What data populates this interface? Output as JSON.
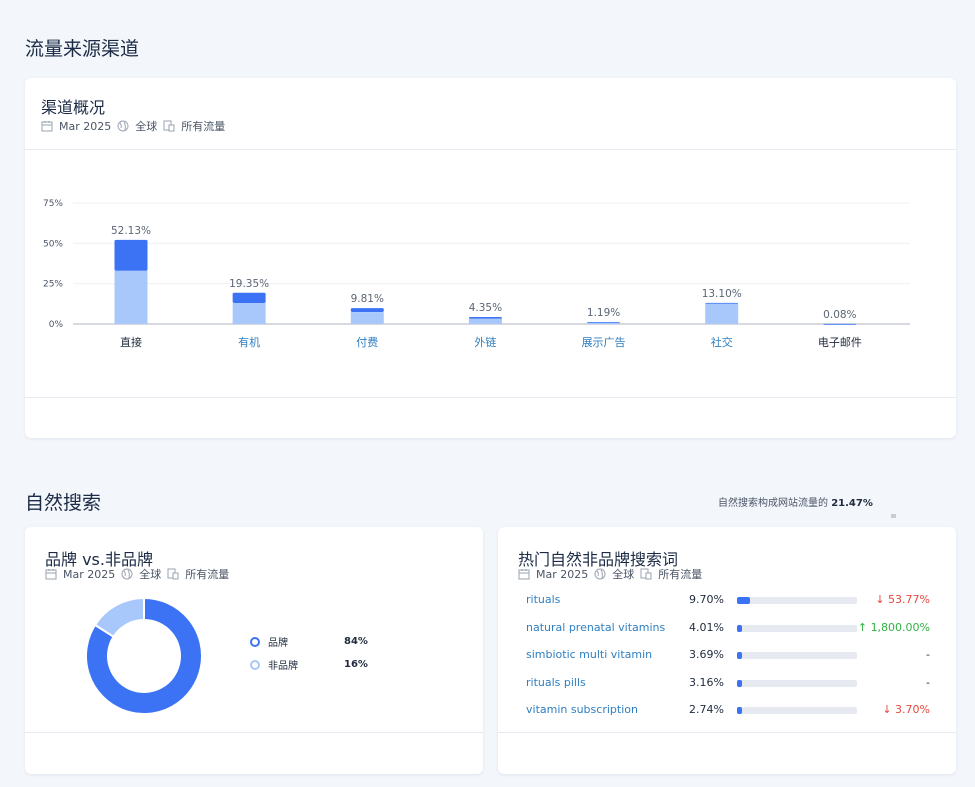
{
  "traffic_section": {
    "title": "流量来源渠道"
  },
  "channel_card": {
    "title": "渠道概况",
    "meta": {
      "date": "Mar 2025",
      "region": "全球",
      "traffic": "所有流量"
    }
  },
  "chart_data": {
    "type": "bar",
    "title": "",
    "ylabel": "",
    "ylim": [
      0,
      75
    ],
    "yticks": [
      "0%",
      "25%",
      "50%",
      "75%"
    ],
    "yticks_values": [
      0,
      25,
      50,
      75
    ],
    "categories": [
      "直接",
      "有机",
      "付费",
      "外链",
      "展示广告",
      "社交",
      "电子邮件"
    ],
    "values": [
      52.13,
      19.35,
      9.81,
      4.35,
      1.19,
      13.1,
      0.08
    ],
    "data_labels": [
      "52.13%",
      "19.35%",
      "9.81%",
      "4.35%",
      "1.19%",
      "13.10%",
      "0.08%"
    ],
    "lower_segment_values": [
      33.0,
      13.0,
      7.4,
      3.3,
      1.0,
      12.7,
      0.06
    ],
    "category_link": [
      false,
      true,
      true,
      true,
      true,
      true,
      false
    ],
    "colors": {
      "top": "#3b73f4",
      "bottom": "#a8c8fb",
      "link": "#2e7fc1",
      "text": "#1f2a3c"
    },
    "grid": true
  },
  "organic_section": {
    "title": "自然搜索",
    "share_text": "自然搜索构成网站流量的",
    "share_value": "21.47%"
  },
  "brand_card": {
    "title": "品牌 vs.非品牌",
    "meta": {
      "date": "Mar 2025",
      "region": "全球",
      "traffic": "所有流量"
    },
    "donut": [
      {
        "label": "品牌",
        "value": "84%",
        "fraction": 0.84,
        "color": "#3b73f4"
      },
      {
        "label": "非品牌",
        "value": "16%",
        "fraction": 0.16,
        "color": "#a8c8fb"
      }
    ]
  },
  "keywords_card": {
    "title": "热门自然非品牌搜索词",
    "meta": {
      "date": "Mar 2025",
      "region": "全球",
      "traffic": "所有流量"
    },
    "rows": [
      {
        "keyword": "rituals",
        "share": "9.70%",
        "fraction": 0.097,
        "change": "53.77%",
        "dir": "down"
      },
      {
        "keyword": "natural prenatal vitamins",
        "share": "4.01%",
        "fraction": 0.0401,
        "change": "1,800.00%",
        "dir": "up"
      },
      {
        "keyword": "simbiotic multi vitamin",
        "share": "3.69%",
        "fraction": 0.0369,
        "change": "-",
        "dir": "none"
      },
      {
        "keyword": "rituals pills",
        "share": "3.16%",
        "fraction": 0.0316,
        "change": "-",
        "dir": "none"
      },
      {
        "keyword": "vitamin subscription",
        "share": "2.74%",
        "fraction": 0.0274,
        "change": "3.70%",
        "dir": "down"
      }
    ]
  },
  "icons": {
    "calendar": "calendar-icon",
    "globe": "globe-icon",
    "devices": "devices-icon"
  }
}
